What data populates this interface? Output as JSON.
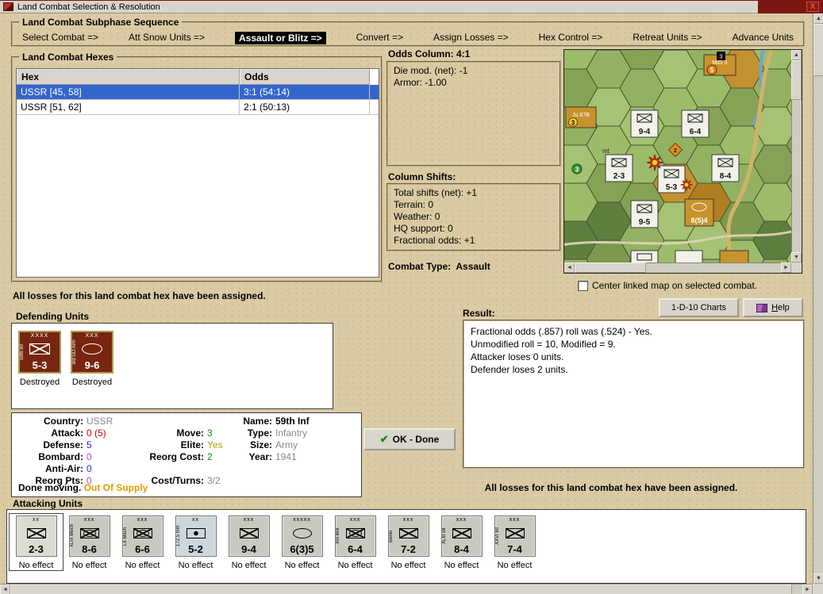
{
  "colors": {
    "desktop_tan": "#dbcba4",
    "selection_blue": "#3465cd",
    "frame_maroon": "#7c1612",
    "ussr_counter": "#77250e",
    "german_counter": "#c6cac0"
  },
  "icons": {
    "check": "✔",
    "arrow_up": "▲",
    "arrow_down": "▼",
    "arrow_left": "◄",
    "arrow_right": "►"
  },
  "window": {
    "title": "Land Combat Selection & Resolution",
    "close_label": "X"
  },
  "sequence": {
    "title": "Land Combat Subphase Sequence",
    "active_index": 2,
    "items": [
      {
        "label": "Select Combat =>"
      },
      {
        "label": "Att Snow Units =>"
      },
      {
        "label": "Assault or Blitz =>"
      },
      {
        "label": "Convert =>"
      },
      {
        "label": "Assign Losses =>"
      },
      {
        "label": "Hex Control =>"
      },
      {
        "label": "Retreat Units =>"
      },
      {
        "label": "Advance Units"
      }
    ]
  },
  "hexes": {
    "title": "Land Combat Hexes",
    "columns": [
      "Hex",
      "Odds"
    ],
    "selected_row": 0,
    "rows": [
      {
        "hex": "USSR [45, 58]",
        "odds": "3:1 (54:14)"
      },
      {
        "hex": "USSR [51, 62]",
        "odds": "2:1 (50:13)"
      }
    ]
  },
  "odds_column": {
    "title": "Odds Column: 4:1",
    "lines": [
      "Die mod. (net): -1",
      "Armor: -1.00"
    ]
  },
  "column_shifts": {
    "title": "Column Shifts:",
    "lines": [
      "Total shifts (net): +1",
      "Terrain: 0",
      "Weather: 0",
      "HQ support: 0",
      "Fractional odds: +1"
    ]
  },
  "combat_type": {
    "label": "Combat Type:",
    "value": "Assault"
  },
  "map": {
    "counters": [
      "9-4",
      "6-4",
      "2-3",
      "5-3",
      "8-4",
      "9-5",
      "8(5)4"
    ],
    "air_units": [
      "MiG-3",
      "Ju 87B"
    ],
    "badges": [
      "3",
      "5",
      "3",
      "2",
      "3"
    ],
    "terrain_label": "mt",
    "checkbox_label": "Center linked map on selected combat.",
    "checkbox_checked": false
  },
  "buttons": {
    "charts": "1-D-10 Charts",
    "help": "Help",
    "ok_done": "OK - Done"
  },
  "messages": {
    "left": "All losses for this land combat hex have been assigned.",
    "right": "All losses for this land combat hex have been assigned."
  },
  "defending": {
    "title": "Defending Units",
    "units": [
      {
        "size": "XXXX",
        "side": "59th Inf",
        "value": "5-3",
        "status": "Destroyed",
        "symbol": "inf"
      },
      {
        "size": "XXX",
        "side": "3rd GD Arm",
        "value": "9-6",
        "status": "Destroyed",
        "symbol": "armor"
      }
    ]
  },
  "unit_info": {
    "col1": [
      {
        "label": "Country:",
        "value": "USSR"
      },
      {
        "label": "Attack:",
        "value": "0 (5)"
      },
      {
        "label": "Defense:",
        "value": "5"
      },
      {
        "label": "Bombard:",
        "value": "0"
      },
      {
        "label": "Anti-Air:",
        "value": "0"
      },
      {
        "label": "Reorg Pts:",
        "value": "0"
      }
    ],
    "col2": [
      {
        "label": "Move:",
        "value": "3"
      },
      {
        "label": "Elite:",
        "value": "Yes"
      },
      {
        "label": "Reorg Cost:",
        "value": "2"
      },
      {
        "label": "Cost/Turns:",
        "value": "3/2"
      }
    ],
    "col3": [
      {
        "label": "Name:",
        "value": "59th Inf"
      },
      {
        "label": "Type:",
        "value": "Infantry"
      },
      {
        "label": "Size:",
        "value": "Army"
      },
      {
        "label": "Year:",
        "value": "1941"
      }
    ],
    "footer": {
      "moving": "Done moving.",
      "supply": "Out Of Supply"
    }
  },
  "result": {
    "title": "Result:",
    "lines": [
      "Fractional odds (.857) roll was (.524)  - Yes.",
      "Unmodified roll = 10, Modified = 9.",
      "Attacker loses 0 units.",
      "Defender loses 2 units."
    ]
  },
  "attacking": {
    "title": "Attacking Units",
    "units": [
      {
        "size": "xx",
        "side": "",
        "value": "2-3",
        "status": "No effect",
        "symbol": "inf"
      },
      {
        "size": "xxx",
        "side": "XLVI Mech",
        "value": "8-6",
        "status": "No effect",
        "symbol": "mech"
      },
      {
        "size": "xxx",
        "side": "LII Mech",
        "value": "6-6",
        "status": "No effect",
        "symbol": "mech"
      },
      {
        "size": "xx",
        "side": "172.5 mm",
        "value": "5-2",
        "status": "No effect",
        "symbol": "artillery"
      },
      {
        "size": "xxx",
        "side": "",
        "value": "9-4",
        "status": "No effect",
        "symbol": "inf"
      },
      {
        "size": "xxxxx",
        "side": "",
        "value": "6(3)5",
        "status": "No effect",
        "symbol": "armor"
      },
      {
        "size": "xxx",
        "side": "XIII Mot",
        "value": "6-4",
        "status": "No effect",
        "symbol": "mech"
      },
      {
        "size": "xxx",
        "side": "Berlin",
        "value": "7-2",
        "status": "No effect",
        "symbol": "inf"
      },
      {
        "size": "xxx",
        "side": "XLIII Inf",
        "value": "8-4",
        "status": "No effect",
        "symbol": "inf"
      },
      {
        "size": "xxx",
        "side": "XXVI Inf",
        "value": "7-4",
        "status": "No effect",
        "symbol": "inf"
      }
    ]
  }
}
